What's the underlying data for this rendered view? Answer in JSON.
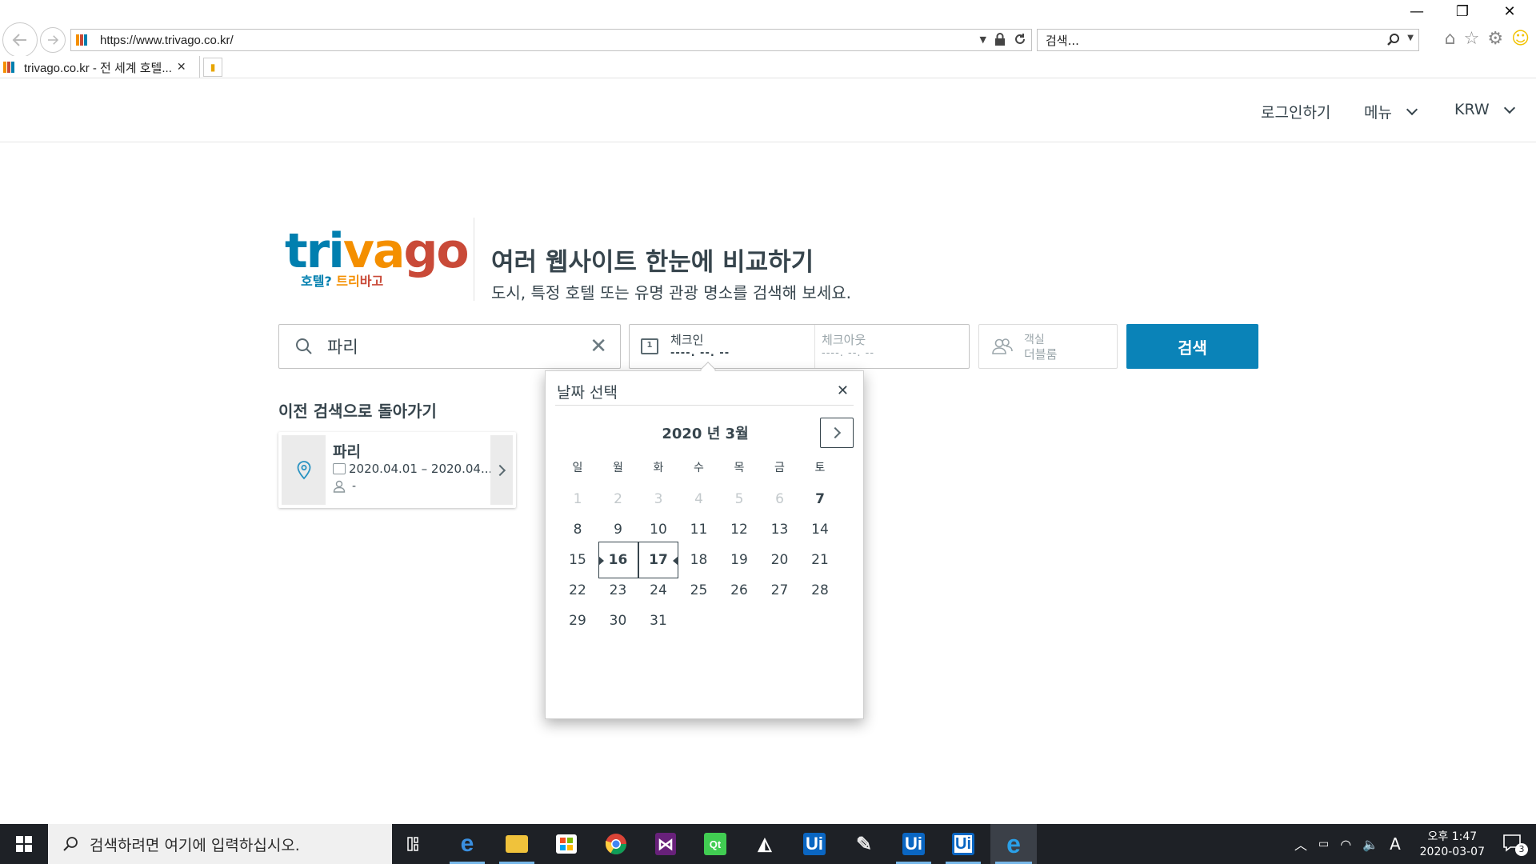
{
  "browser": {
    "url": "https://www.trivago.co.kr/",
    "search_placeholder": "검색...",
    "tab_title": "trivago.co.kr - 전 세계 호텔...",
    "favicon_colors": [
      "#f48f00",
      "#c94a38",
      "#007faf"
    ]
  },
  "header": {
    "login": "로그인하기",
    "menu": "메뉴",
    "currency": "KRW"
  },
  "logo": {
    "word_parts": [
      "tri",
      "va",
      "go"
    ],
    "sub_parts": [
      "호텔? ",
      "트리",
      "바고"
    ]
  },
  "hero": {
    "title": "여러 웹사이트 한눈에 비교하기",
    "subtitle": "도시, 특정 호텔 또는 유명 관광 명소를 검색해 보세요."
  },
  "search": {
    "destination": "파리",
    "checkin_label": "체크인",
    "checkin_value": "----. --. --",
    "checkout_label": "체크아웃",
    "checkout_value": "----. --. --",
    "rooms_label": "객실",
    "rooms_value": "더블룸",
    "button": "검색"
  },
  "recent": {
    "title": "이전 검색으로 돌아가기",
    "item": {
      "name": "파리",
      "dates": "2020.04.01 – 2020.04...",
      "guests": "-"
    }
  },
  "datepicker": {
    "title": "날짜 선택",
    "month": "2020 년 3월",
    "weekdays": [
      "일",
      "월",
      "화",
      "수",
      "목",
      "금",
      "토"
    ],
    "days": [
      [
        "1",
        "2",
        "3",
        "4",
        "5",
        "6",
        "7"
      ],
      [
        "8",
        "9",
        "10",
        "11",
        "12",
        "13",
        "14"
      ],
      [
        "15",
        "16",
        "17",
        "18",
        "19",
        "20",
        "21"
      ],
      [
        "22",
        "23",
        "24",
        "25",
        "26",
        "27",
        "28"
      ],
      [
        "29",
        "30",
        "31"
      ]
    ],
    "past_days": [
      "1",
      "2",
      "3",
      "4",
      "5",
      "6"
    ],
    "today": "7",
    "selected_start": "16",
    "selected_end": "17"
  },
  "taskbar": {
    "search_placeholder": "검색하려면 여기에 입력하십시오.",
    "clock_period": "오후 1:47",
    "clock_date": "2020-03-07",
    "notification_count": "3",
    "ime": "A",
    "apps": [
      "task-view",
      "edge",
      "file-explorer",
      "store",
      "chrome",
      "visual-studio",
      "qt-creator",
      "unity",
      "uipath-studio",
      "paint",
      "uipath-robot",
      "uipath-assistant",
      "internet-explorer"
    ]
  },
  "colors": {
    "brand_blue": "#007faf",
    "brand_orange": "#f48f00",
    "brand_red": "#c94a38",
    "search_button": "#0a83b8",
    "text": "#37454d"
  }
}
